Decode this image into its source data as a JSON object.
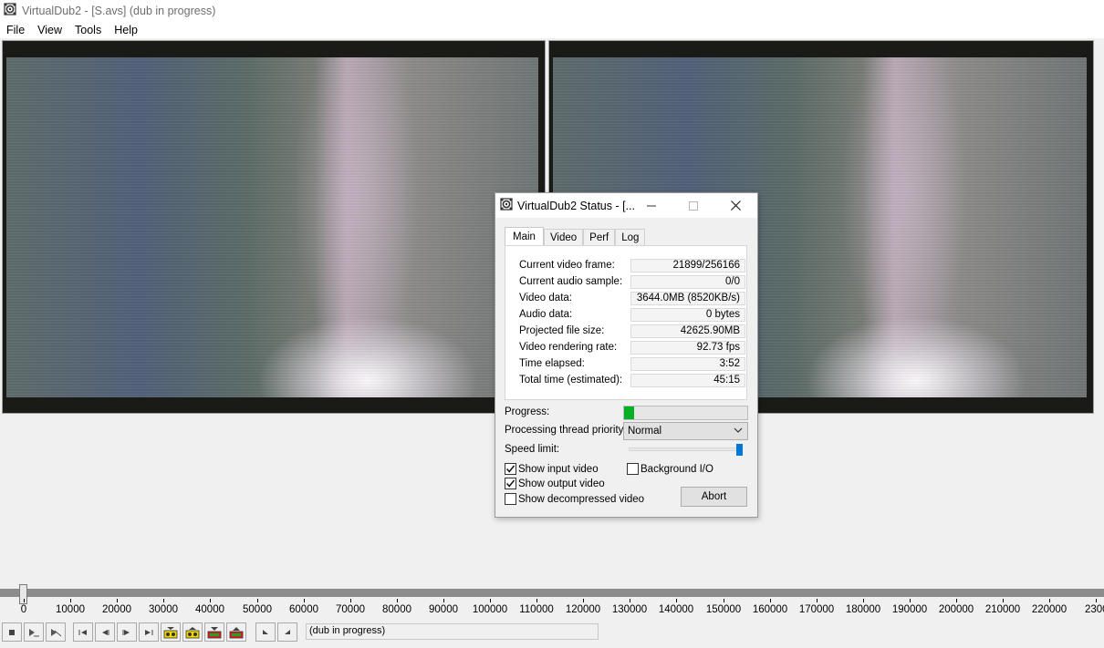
{
  "window": {
    "title": "VirtualDub2  - [S.avs] (dub in progress)"
  },
  "menu": {
    "items": [
      "File",
      "View",
      "Tools",
      "Help"
    ]
  },
  "dialog": {
    "title": "VirtualDub2 Status - [...",
    "tabs": [
      "Main",
      "Video",
      "Perf",
      "Log"
    ],
    "stats": [
      {
        "label": "Current video frame:",
        "value": "21899/256166"
      },
      {
        "label": "Current audio sample:",
        "value": "0/0"
      },
      {
        "label": "Video data:",
        "value": "3644.0MB (8520KB/s)"
      },
      {
        "label": "Audio data:",
        "value": "0 bytes"
      },
      {
        "label": "Projected file size:",
        "value": "42625.90MB"
      },
      {
        "label": "Video rendering rate:",
        "value": "92.73 fps"
      },
      {
        "label": "Time elapsed:",
        "value": "3:52"
      },
      {
        "label": "Total time (estimated):",
        "value": "45:15"
      }
    ],
    "progress_label": "Progress:",
    "progress_fraction": 0.085,
    "priority_label": "Processing thread priority:",
    "priority_value": "Normal",
    "speed_label": "Speed limit:",
    "speed_fraction": 1.0,
    "checks": {
      "show_input": {
        "label": "Show input video",
        "checked": true
      },
      "show_output": {
        "label": "Show output video",
        "checked": true
      },
      "show_decompressed": {
        "label": "Show decompressed video",
        "checked": false
      },
      "background_io": {
        "label": "Background I/O",
        "checked": false
      }
    },
    "abort_label": "Abort"
  },
  "timeline": {
    "ticks": [
      "0",
      "10000",
      "20000",
      "30000",
      "40000",
      "50000",
      "60000",
      "70000",
      "80000",
      "90000",
      "100000",
      "110000",
      "120000",
      "130000",
      "140000",
      "150000",
      "160000",
      "170000",
      "180000",
      "190000",
      "200000",
      "210000",
      "220000",
      "2300"
    ],
    "position_fraction": 0.0
  },
  "status_text": "(dub in progress)",
  "colors": {
    "progress": "#06b025",
    "slider": "#0078d7",
    "timeline": "#8c8c8c"
  }
}
